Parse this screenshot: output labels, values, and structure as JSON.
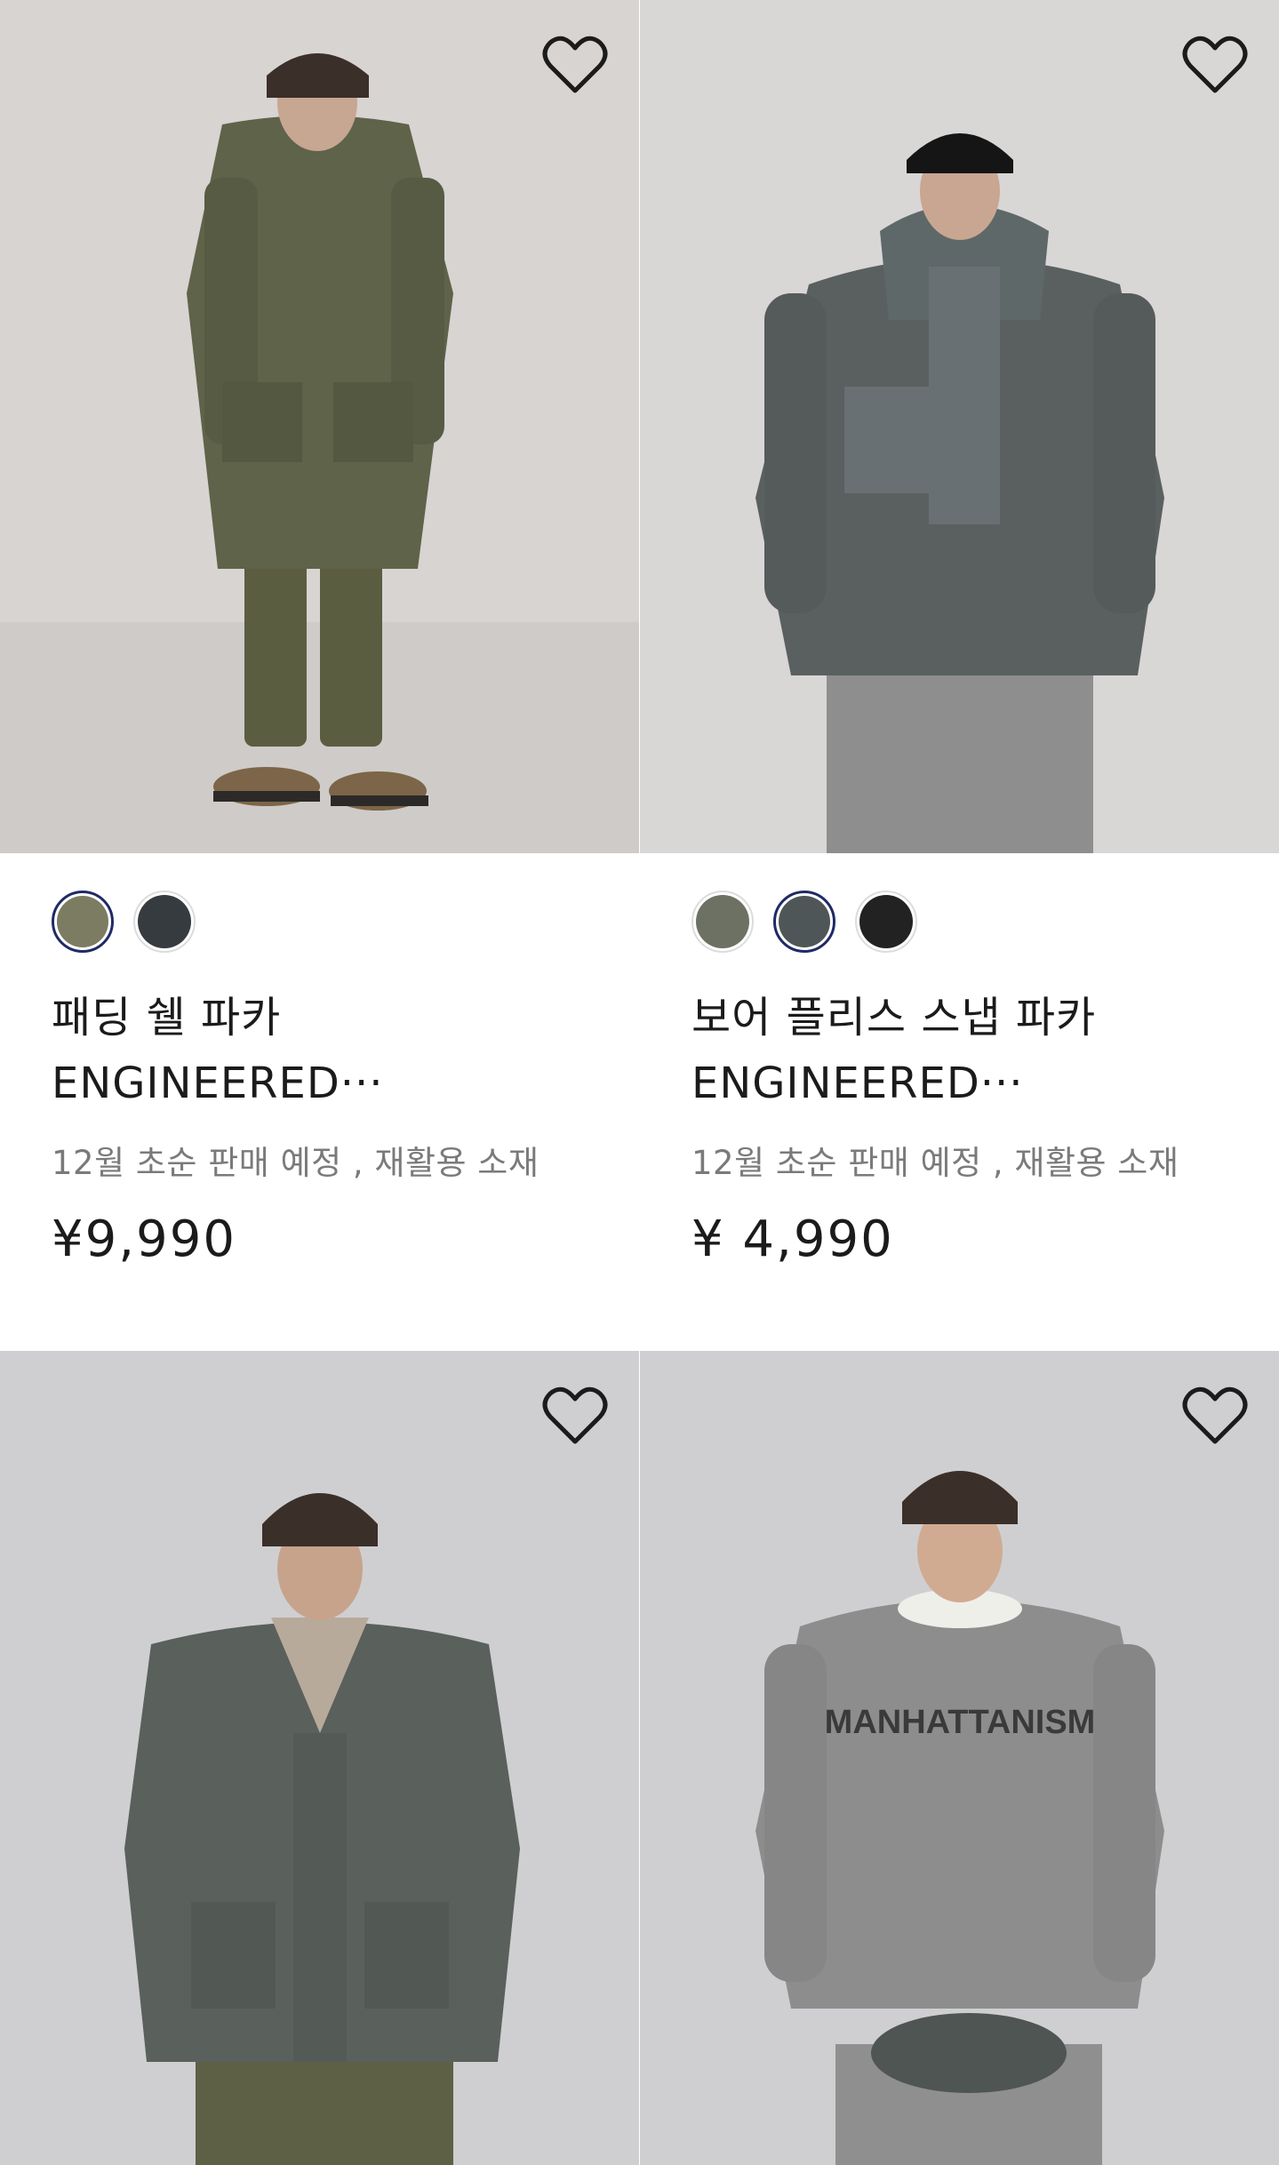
{
  "products": [
    {
      "name_line1": "패딩 쉘 파카",
      "name_line2": "ENGINEERED···",
      "note": "12월 초순 판매 예정 , 재활용 소재",
      "price": "¥9,990",
      "swatches": [
        {
          "color": "#7b7c62",
          "selected": true
        },
        {
          "color": "#363b40",
          "selected": false
        }
      ],
      "background": "#d8d4d2"
    },
    {
      "name_line1": "보어 플리스 스냅 파카",
      "name_line2": "ENGINEERED···",
      "note": "12월 초순 판매 예정 , 재활용 소재",
      "price": "¥ 4,990",
      "swatches": [
        {
          "color": "#6d7163",
          "selected": false
        },
        {
          "color": "#4f5657",
          "selected": true
        },
        {
          "color": "#222222",
          "selected": false
        }
      ],
      "background": "#d9d6d6"
    },
    {
      "background": "#cfcfd1"
    },
    {
      "print_text": "MANHATTANISM",
      "background": "#cfcfd1"
    }
  ],
  "colors": {
    "selected_ring": "#1f2a66",
    "price": "#1b1b1b",
    "note": "#7a7a7a"
  },
  "icons": {
    "favorite": "heart-outline-icon"
  }
}
